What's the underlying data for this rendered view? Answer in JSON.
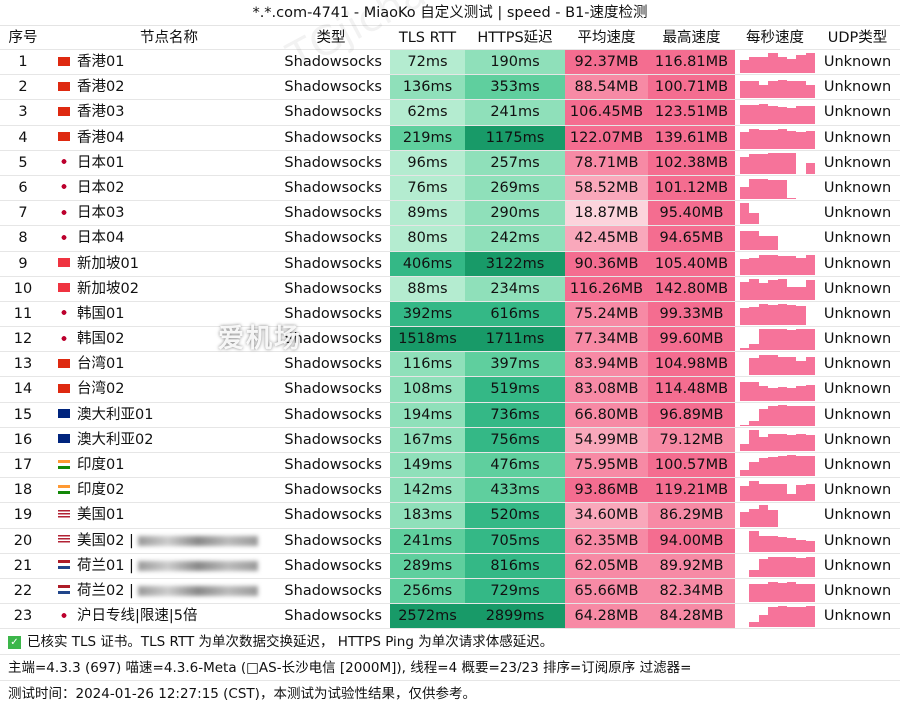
{
  "title": "*.*.com-4741 - MiaoKo 自定义测试 | speed - B1-速度检测",
  "headers": [
    "序号",
    "节点名称",
    "类型",
    "TLS RTT",
    "HTTPS延迟",
    "平均速度",
    "最高速度",
    "每秒速度",
    "UDP类型"
  ],
  "flag_colors": {
    "hk": "#de2910",
    "jp": "#ffffff",
    "sg": "#ef3340",
    "kr": "#ffffff",
    "tw": "#de2910",
    "au": "#00247d",
    "in": "#ff9933",
    "us": "#b22234",
    "nl": "#21468b"
  },
  "rows": [
    {
      "no": "1",
      "flag": "hk",
      "name": "香港01",
      "type": "Shadowsocks",
      "tls": "72ms",
      "https": "190ms",
      "avg": "92.37MB",
      "max": "116.81MB",
      "udp": "Unknown",
      "spark": [
        0.6,
        0.75,
        0.75,
        0.9,
        0.75,
        0.65,
        0.8,
        0.9
      ]
    },
    {
      "no": "2",
      "flag": "hk",
      "name": "香港02",
      "type": "Shadowsocks",
      "tls": "136ms",
      "https": "353ms",
      "avg": "88.54MB",
      "max": "100.71MB",
      "udp": "Unknown",
      "spark": [
        0.8,
        0.8,
        0.6,
        0.8,
        0.85,
        0.8,
        0.8,
        0.6
      ]
    },
    {
      "no": "3",
      "flag": "hk",
      "name": "香港03",
      "type": "Shadowsocks",
      "tls": "62ms",
      "https": "241ms",
      "avg": "106.45MB",
      "max": "123.51MB",
      "udp": "Unknown",
      "spark": [
        0.85,
        0.85,
        0.9,
        0.8,
        0.75,
        0.7,
        0.8,
        0.8
      ]
    },
    {
      "no": "4",
      "flag": "hk",
      "name": "香港04",
      "type": "Shadowsocks",
      "tls": "219ms",
      "https": "1175ms",
      "avg": "122.07MB",
      "max": "139.61MB",
      "udp": "Unknown",
      "spark": [
        0.75,
        0.9,
        0.85,
        0.85,
        0.9,
        0.8,
        0.75,
        0.8
      ]
    },
    {
      "no": "5",
      "flag": "jp",
      "name": "日本01",
      "type": "Shadowsocks",
      "tls": "96ms",
      "https": "257ms",
      "avg": "78.71MB",
      "max": "102.38MB",
      "udp": "Unknown",
      "spark": [
        0.75,
        0.9,
        0.9,
        0.95,
        0.95,
        0.95,
        0,
        0.5
      ]
    },
    {
      "no": "6",
      "flag": "jp",
      "name": "日本02",
      "type": "Shadowsocks",
      "tls": "76ms",
      "https": "269ms",
      "avg": "58.52MB",
      "max": "101.12MB",
      "udp": "Unknown",
      "spark": [
        0.55,
        0.9,
        0.9,
        0.85,
        0.85,
        0.05,
        0,
        0
      ]
    },
    {
      "no": "7",
      "flag": "jp",
      "name": "日本03",
      "type": "Shadowsocks",
      "tls": "89ms",
      "https": "290ms",
      "avg": "18.87MB",
      "max": "95.40MB",
      "udp": "Unknown",
      "spark": [
        0.95,
        0.5,
        0,
        0,
        0,
        0,
        0,
        0
      ]
    },
    {
      "no": "8",
      "flag": "jp",
      "name": "日本04",
      "type": "Shadowsocks",
      "tls": "80ms",
      "https": "242ms",
      "avg": "42.45MB",
      "max": "94.65MB",
      "udp": "Unknown",
      "spark": [
        0.85,
        0.85,
        0.6,
        0.6,
        0,
        0,
        0,
        0
      ]
    },
    {
      "no": "9",
      "flag": "sg",
      "name": "新加坡01",
      "type": "Shadowsocks",
      "tls": "406ms",
      "https": "3122ms",
      "avg": "90.36MB",
      "max": "105.40MB",
      "udp": "Unknown",
      "spark": [
        0.7,
        0.75,
        0.9,
        0.9,
        0.85,
        0.85,
        0.75,
        0.9
      ]
    },
    {
      "no": "10",
      "flag": "sg",
      "name": "新加坡02",
      "type": "Shadowsocks",
      "tls": "88ms",
      "https": "234ms",
      "avg": "116.26MB",
      "max": "142.80MB",
      "udp": "Unknown",
      "spark": [
        0.8,
        0.95,
        0.75,
        0.9,
        0.95,
        0.6,
        0.6,
        0.9
      ]
    },
    {
      "no": "11",
      "flag": "kr",
      "name": "韩国01",
      "type": "Shadowsocks",
      "tls": "392ms",
      "https": "616ms",
      "avg": "75.24MB",
      "max": "99.33MB",
      "udp": "Unknown",
      "spark": [
        0.75,
        0.8,
        0.95,
        0.9,
        0.95,
        0.9,
        0.85,
        0
      ]
    },
    {
      "no": "12",
      "flag": "kr",
      "name": "韩国02",
      "type": "Shadowsocks",
      "tls": "1518ms",
      "https": "1711ms",
      "avg": "77.34MB",
      "max": "99.60MB",
      "udp": "Unknown",
      "spark": [
        0.1,
        0.3,
        0.95,
        0.95,
        0.95,
        0.9,
        0.95,
        0.95
      ]
    },
    {
      "no": "13",
      "flag": "tw",
      "name": "台湾01",
      "type": "Shadowsocks",
      "tls": "116ms",
      "https": "397ms",
      "avg": "83.94MB",
      "max": "104.98MB",
      "udp": "Unknown",
      "spark": [
        0,
        0.8,
        0.9,
        0.9,
        0.85,
        0.85,
        0.65,
        0.85
      ]
    },
    {
      "no": "14",
      "flag": "tw",
      "name": "台湾02",
      "type": "Shadowsocks",
      "tls": "108ms",
      "https": "519ms",
      "avg": "83.08MB",
      "max": "114.48MB",
      "udp": "Unknown",
      "spark": [
        0.85,
        0.85,
        0.65,
        0.55,
        0.6,
        0.55,
        0.65,
        0.7
      ]
    },
    {
      "no": "15",
      "flag": "au",
      "name": "澳大利亚01",
      "type": "Shadowsocks",
      "tls": "194ms",
      "https": "736ms",
      "avg": "66.80MB",
      "max": "96.89MB",
      "udp": "Unknown",
      "spark": [
        0.05,
        0.2,
        0.75,
        0.9,
        0.95,
        0.9,
        0.9,
        0.9
      ]
    },
    {
      "no": "16",
      "flag": "au",
      "name": "澳大利亚02",
      "type": "Shadowsocks",
      "tls": "167ms",
      "https": "756ms",
      "avg": "54.99MB",
      "max": "79.12MB",
      "udp": "Unknown",
      "spark": [
        0.3,
        0.95,
        0.65,
        0.75,
        0.75,
        0.7,
        0.75,
        0.7
      ]
    },
    {
      "no": "17",
      "flag": "in",
      "name": "印度01",
      "type": "Shadowsocks",
      "tls": "149ms",
      "https": "476ms",
      "avg": "75.95MB",
      "max": "100.57MB",
      "udp": "Unknown",
      "spark": [
        0.3,
        0.65,
        0.8,
        0.85,
        0.9,
        0.95,
        0.9,
        0.9
      ]
    },
    {
      "no": "18",
      "flag": "in",
      "name": "印度02",
      "type": "Shadowsocks",
      "tls": "142ms",
      "https": "433ms",
      "avg": "93.86MB",
      "max": "119.21MB",
      "udp": "Unknown",
      "spark": [
        0.7,
        0.9,
        0.8,
        0.8,
        0.8,
        0.35,
        0.75,
        0.8
      ]
    },
    {
      "no": "19",
      "flag": "us",
      "name": "美国01",
      "type": "Shadowsocks",
      "tls": "183ms",
      "https": "520ms",
      "avg": "34.60MB",
      "max": "86.29MB",
      "udp": "Unknown",
      "spark": [
        0.65,
        0.8,
        0.95,
        0.75,
        0,
        0,
        0,
        0
      ]
    },
    {
      "no": "20",
      "flag": "us",
      "name": "美国02 |",
      "type": "Shadowsocks",
      "tls": "241ms",
      "https": "705ms",
      "avg": "62.35MB",
      "max": "94.00MB",
      "udp": "Unknown",
      "spark": [
        0,
        0.95,
        0.7,
        0.7,
        0.65,
        0.6,
        0.55,
        0.5
      ]
    },
    {
      "no": "21",
      "flag": "nl",
      "name": "荷兰01 |",
      "type": "Shadowsocks",
      "tls": "289ms",
      "https": "816ms",
      "avg": "62.05MB",
      "max": "89.92MB",
      "udp": "Unknown",
      "spark": [
        0,
        0.3,
        0.8,
        0.9,
        0.9,
        0.9,
        0.85,
        0.9
      ]
    },
    {
      "no": "22",
      "flag": "nl",
      "name": "荷兰02 |",
      "type": "Shadowsocks",
      "tls": "256ms",
      "https": "729ms",
      "avg": "65.66MB",
      "max": "82.34MB",
      "udp": "Unknown",
      "spark": [
        0,
        0.8,
        0.8,
        0.9,
        0.85,
        0.9,
        0.8,
        0.8
      ]
    },
    {
      "no": "23",
      "flag": "jp",
      "name": "沪日专线|限速|5倍",
      "type": "Shadowsocks",
      "tls": "2572ms",
      "https": "2899ms",
      "avg": "64.28MB",
      "max": "84.28MB",
      "udp": "Unknown",
      "spark": [
        0,
        0.25,
        0.55,
        0.9,
        0.95,
        0.9,
        0.9,
        0.95
      ]
    }
  ],
  "footer": {
    "line1": "已核实 TLS 证书。TLS RTT 为单次数据交换延迟， HTTPS Ping 为单次请求体感延迟。",
    "line2": "主端=4.3.3 (697) 喵速=4.3.6-Meta (□AS-长沙电信 [2000M]), 线程=4 概要=23/23 排序=订阅原序 过滤器=",
    "line3": "测试时间：2024-01-26 12:27:15 (CST)，本测试为试验性结果，仅供参考。"
  },
  "watermark": "爱机场",
  "colors": {
    "green_scale": [
      "#b4ecd0",
      "#8fe0ba",
      "#5fcf9e",
      "#34b886",
      "#189a68"
    ],
    "pink_scale": [
      "#fcd4dc",
      "#f9a8bb",
      "#f78aa5",
      "#f46d90"
    ],
    "spark": "#f6739a"
  }
}
